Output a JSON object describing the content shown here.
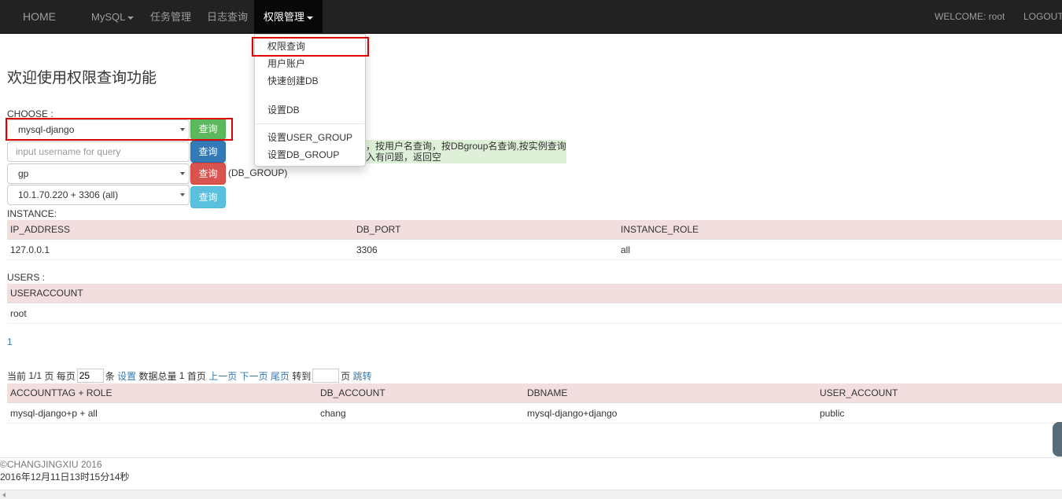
{
  "nav": {
    "home": "HOME",
    "mysql": "MySQL",
    "task": "任务管理",
    "log": "日志查询",
    "perm": "权限管理",
    "welcome": "WELCOME: root",
    "logout": "LOGOUT"
  },
  "dropdown": {
    "items": [
      "权限查询",
      "用户账户",
      "快速创建DB",
      "设置DB",
      "设置USER_GROUP",
      "设置DB_GROUP"
    ]
  },
  "page": {
    "title": "欢迎使用权限查询功能",
    "choose_label": "CHOOSE :"
  },
  "query": {
    "select1_value": "mysql-django",
    "input_placeholder": "input username for query",
    "select2_value": "gp",
    "select3_value": "10.1.70.220 + 3306 (all)",
    "button_label": "查询",
    "group_note": "(DB_GROUP)",
    "tip_line1": "，按用户名查询，按DBgroup名查询,按实例查询",
    "tip_line2": "入有问题，返回空"
  },
  "instance": {
    "label": "INSTANCE:",
    "headers": [
      "IP_ADDRESS",
      "DB_PORT",
      "INSTANCE_ROLE"
    ],
    "rows": [
      [
        "127.0.0.1",
        "3306",
        "all"
      ]
    ]
  },
  "users": {
    "label": "USERS :",
    "headers": [
      "USERACCOUNT"
    ],
    "rows": [
      [
        "root"
      ]
    ],
    "page_link": "1"
  },
  "pager": {
    "current": "当前",
    "page_num": "1/1",
    "page_per": "页 每页",
    "per_value": "25",
    "tiao": "条",
    "set": "设置",
    "total_label": "数据总量",
    "total": "1",
    "first": "首页",
    "prev": "上一页",
    "next": "下一页",
    "last": "尾页",
    "goto_label": "转到",
    "ye": "页",
    "jump": "跳转"
  },
  "accounts": {
    "headers": [
      "ACCOUNTTAG + ROLE",
      "DB_ACCOUNT",
      "DBNAME",
      "USER_ACCOUNT"
    ],
    "rows": [
      [
        "mysql-django+p + all",
        "chang",
        "mysql-django+django",
        "public"
      ]
    ]
  },
  "footer": {
    "copyright": "©CHANGJINGXIU 2016",
    "timestamp": "2016年12月11日13时15分14秒"
  },
  "colors": {
    "navbar": "#222222",
    "table_header": "#f2dede",
    "highlight": "#dd0000",
    "link": "#337ab7"
  }
}
